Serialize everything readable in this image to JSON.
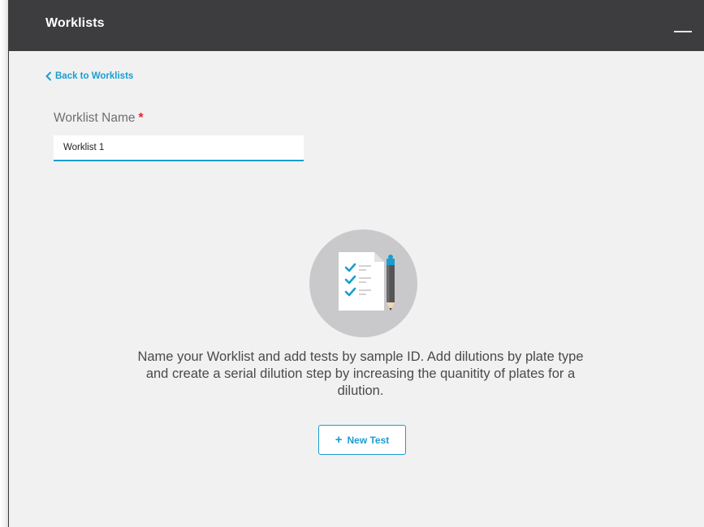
{
  "window": {
    "title": "Worklists"
  },
  "nav": {
    "back_label": "Back to Worklists"
  },
  "form": {
    "name_label": "Worklist Name",
    "required_marker": "*",
    "name_value": "Worklist 1"
  },
  "empty_state": {
    "icon": "checklist-document-pencil-icon",
    "message": "Name your Worklist and add tests by sample ID. Add dilutions by plate type and create a serial dilution step by increasing the quanitity of plates for a dilution.",
    "button_label": "New Test",
    "button_icon": "plus-icon"
  },
  "colors": {
    "titlebar": "#3d3d3f",
    "accent": "#1a9dd1",
    "required": "#e0262d",
    "background": "#f1f1f2",
    "checkmark": "#1a9dd1"
  }
}
